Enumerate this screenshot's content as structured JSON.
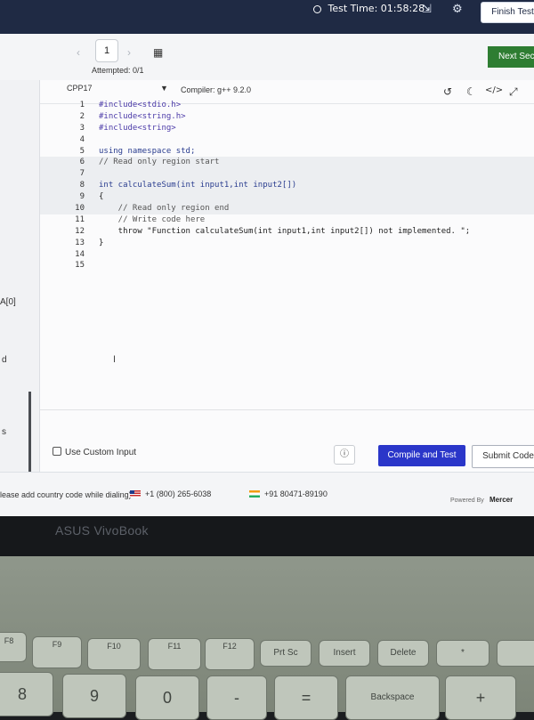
{
  "topbar": {
    "timer_label": "Test Time: 01:58:28",
    "finish_label": "Finish Test"
  },
  "nav": {
    "prev": "‹",
    "page": "1",
    "next": "›",
    "attempted": "Attempted: 0/1",
    "next_section": "Next Sect"
  },
  "left_panel": {
    "snippet_1": "A[0]",
    "snippet_2": "d",
    "snippet_3": "s"
  },
  "editor": {
    "language": "CPP17",
    "compiler": "Compiler: g++ 9.2.0",
    "lines": [
      {
        "n": "1",
        "code": "#include<stdio.h>"
      },
      {
        "n": "2",
        "code": "#include<string.h>"
      },
      {
        "n": "3",
        "code": "#include<string>"
      },
      {
        "n": "4",
        "code": ""
      },
      {
        "n": "5",
        "code": "using namespace std;"
      },
      {
        "n": "6",
        "code": "// Read only region start"
      },
      {
        "n": "7",
        "code": ""
      },
      {
        "n": "8",
        "code": "int calculateSum(int input1,int input2[])"
      },
      {
        "n": "9",
        "code": "{"
      },
      {
        "n": "10",
        "code": "    // Read only region end"
      },
      {
        "n": "11",
        "code": "    // Write code here"
      },
      {
        "n": "12",
        "code": "    throw \"Function calculateSum(int input1,int input2[]) not implemented. \";"
      },
      {
        "n": "13",
        "code": "}"
      },
      {
        "n": "14",
        "code": ""
      },
      {
        "n": "15",
        "code": ""
      }
    ],
    "custom_input_label": "Use Custom Input",
    "compile_label": "Compile and Test",
    "submit_label": "Submit Code"
  },
  "footer": {
    "note": "lease add country code while dialing)",
    "phone_us": "+1 (800) 265-6038",
    "phone_in": "+91 80471-89190",
    "powered_by": "Powered By",
    "brand": "Mercer"
  },
  "laptop": {
    "brand": "ASUS VivoBook",
    "keys": [
      "F8",
      "F9",
      "F10",
      "F11",
      "F12",
      "Prt Sc",
      "Insert",
      "Delete",
      "*",
      "8",
      "9",
      "0",
      "-",
      "=",
      "Backspace",
      "+"
    ]
  },
  "colors": {
    "topbar": "#1f2a44",
    "compile_button": "#2a36c9",
    "next_button": "#2e7d32"
  }
}
